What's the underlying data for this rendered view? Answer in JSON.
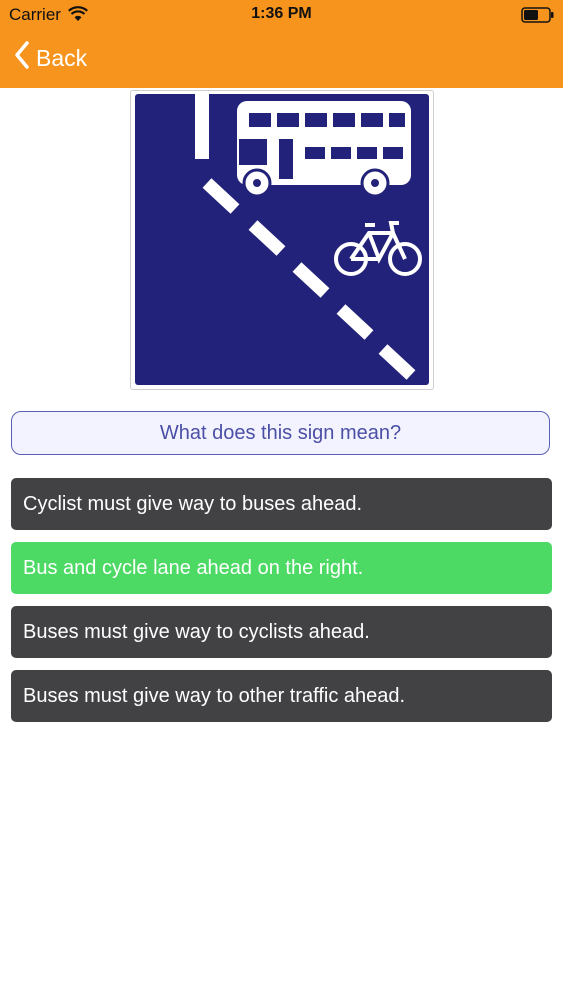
{
  "status_bar": {
    "carrier": "Carrier",
    "time": "1:36 PM"
  },
  "nav": {
    "back_label": "Back"
  },
  "question": {
    "text": "What does this sign mean?"
  },
  "answers": [
    {
      "label": "Cyclist must give way to buses ahead.",
      "state": "default"
    },
    {
      "label": "Bus and cycle lane ahead on the right.",
      "state": "correct"
    },
    {
      "label": "Buses must give way to cyclists ahead.",
      "state": "default"
    },
    {
      "label": "Buses must give way to other traffic ahead.",
      "state": "default"
    }
  ],
  "colors": {
    "nav_bar": "#f7941d",
    "sign_blue": "#23227a",
    "answer_default": "#424244",
    "answer_correct": "#4cd964",
    "question_border": "#5a5fb5"
  }
}
